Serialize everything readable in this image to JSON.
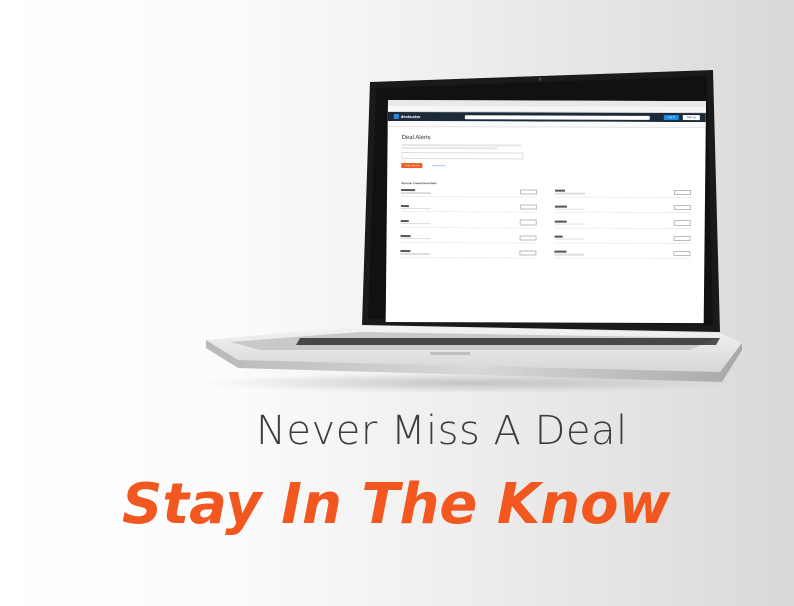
{
  "headline": "Never Miss A Deal",
  "tagline": "Stay In The Know",
  "colors": {
    "accent": "#f1571e",
    "headline": "#3d3d3d",
    "site_header": "#1d2a3a"
  },
  "screen": {
    "site": {
      "logo": "dealmaker",
      "login_label": "Log In",
      "signup_label": "Sign Up"
    },
    "page_title": "Deal Alerts",
    "create_label": "Create Deal Alert",
    "link_label": "Manage Alerts",
    "section_title": "Top User Created Deal Alerts"
  }
}
